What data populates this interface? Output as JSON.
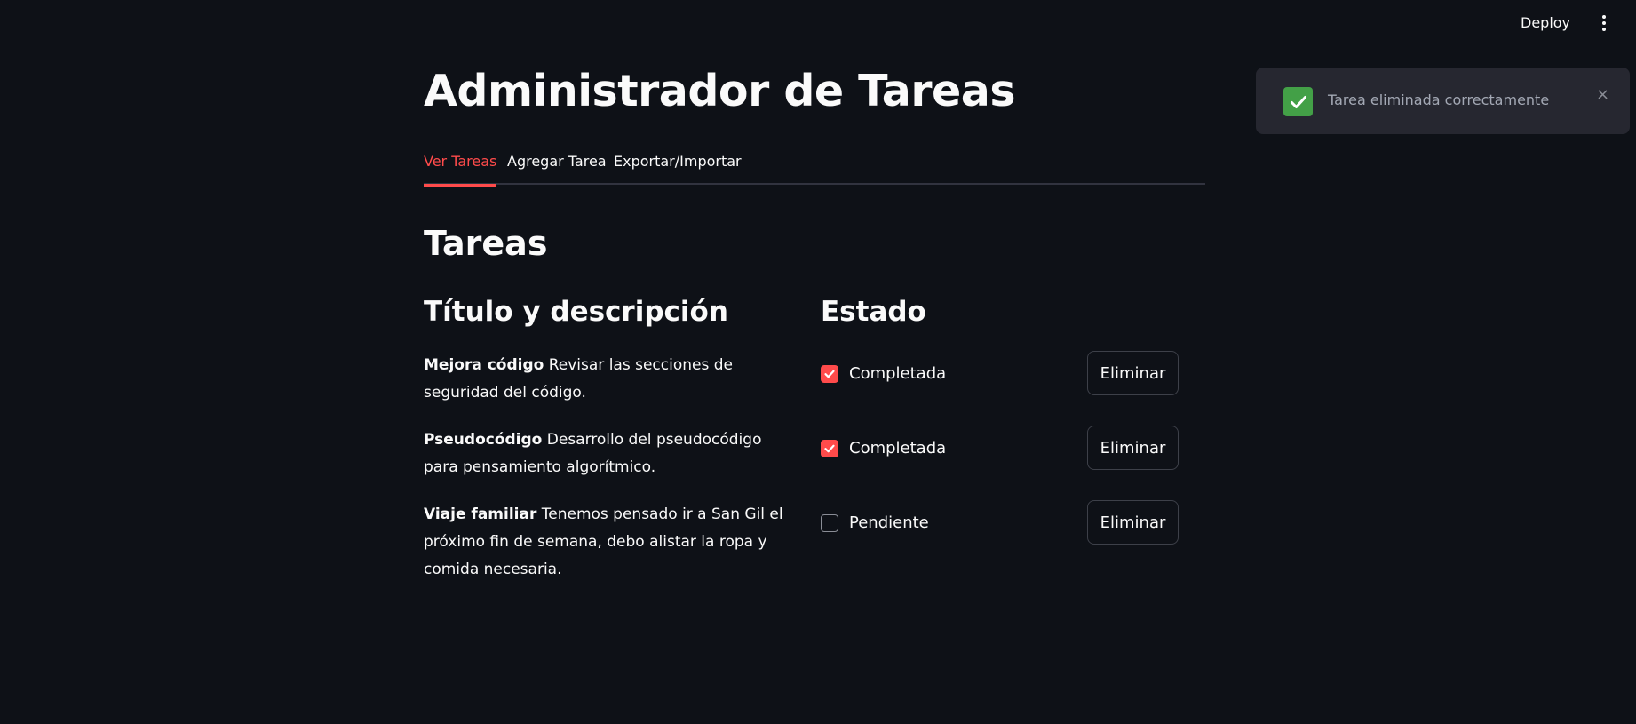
{
  "header": {
    "deploy_label": "Deploy",
    "menu_icon": "kebab-menu-icon"
  },
  "page": {
    "title": "Administrador de Tareas"
  },
  "tabs": [
    {
      "label": "Ver Tareas",
      "active": true
    },
    {
      "label": "Agregar Tarea",
      "active": false
    },
    {
      "label": "Exportar/Importar",
      "active": false
    }
  ],
  "section": {
    "title": "Tareas",
    "col_title": "Título y descripción",
    "col_status": "Estado"
  },
  "tasks": [
    {
      "name": "Mejora código",
      "description": " Revisar las secciones de seguridad del código.",
      "status": "Completada",
      "checked": true,
      "delete_label": "Eliminar"
    },
    {
      "name": "Pseudocódigo",
      "description": " Desarrollo del pseudocódigo para pensamiento algorítmico.",
      "status": "Completada",
      "checked": true,
      "delete_label": "Eliminar"
    },
    {
      "name": "Viaje familiar",
      "description": " Tenemos pensado ir a San Gil el próximo fin de semana, debo alistar la ropa y comida necesaria.",
      "status": "Pendiente",
      "checked": false,
      "delete_label": "Eliminar"
    }
  ],
  "toast": {
    "icon": "check-mark-icon",
    "message": "Tarea eliminada correctamente",
    "close_label": "×"
  },
  "colors": {
    "background": "#0e1117",
    "accent": "#ff4b4b",
    "toast_bg": "#262730",
    "success": "#43a047"
  }
}
